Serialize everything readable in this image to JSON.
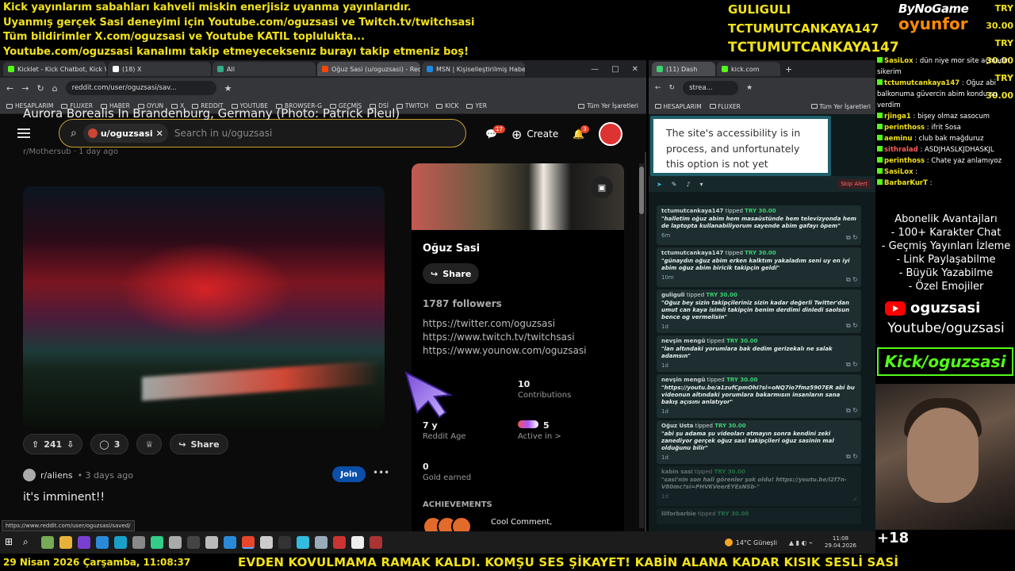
{
  "banner_lines": [
    "Kick yayınlarım sabahları kahveli miskin enerjisiz uyanma yayınlarıdır.",
    "Uyanmış gerçek Sasi deneyimi için Youtube.com/oguzsasi ve Twitch.tv/twitchsasi",
    "Tüm bildirimler X.com/oguzsasi ve Youtube KATIL toplulukta...",
    "Youtube.com/oguzsasi kanalımı takip etmeyeceksenız burayı takip etmeniz boş!"
  ],
  "top_tippers": [
    "GULIGULI",
    "TCTUMUTCANKAYA147",
    "TCTUMUTCANKAYA147"
  ],
  "brand": {
    "line1": "ByNoGame",
    "line2": "oyunfor"
  },
  "top_amounts": [
    "TRY 30.00",
    "TRY 30.00",
    "TRY 30.00"
  ],
  "left_browser": {
    "tabs": [
      "Kicklet - Kick Chatbot, Kick W...",
      "(18) X",
      "All",
      "Oğuz Sasi (u/oguzsasi) - Redd...",
      "MSN | Kişiselleştirilmiş Haber..."
    ],
    "url": "reddit.com/user/oguzsasi/sav...",
    "bookmarks": [
      "HESAPLARIM",
      "FLUXER",
      "HABER",
      "OYUN",
      "X",
      "REDDIT",
      "YOUTUBE",
      "BROWSER-G",
      "GEÇMİŞ",
      "DSİ",
      "TWITCH",
      "KICK",
      "YER",
      "Tüm Yer İşaretleri"
    ],
    "search_chip": "u/oguzsasi",
    "search_placeholder": "Search in u/oguzsasi",
    "chat_badge": "17",
    "notif_badge": "3",
    "create_label": "Create",
    "post_meta": "r/Mothersub · 1 day ago",
    "post_title": "Aurora Borealis In Brandenburg, Germany (Photo: Patrick Pleul)",
    "upvotes": "241",
    "comments": "3",
    "share": "Share",
    "post2_sub": "r/aliens",
    "post2_time": "• 3 days ago",
    "join": "Join",
    "post2_title": "it's imminent!!",
    "status_url": "https://www.reddit.com/user/oguzsasi/saved/"
  },
  "profile": {
    "name": "Oğuz Sasi",
    "share": "Share",
    "followers": "1787 followers",
    "links": [
      "https://twitter.com/oguzsasi",
      "https://www.twitch.tv/twitchsasi",
      "https://www.younow.com/oguzsasi"
    ],
    "contributions_value": "10",
    "contributions_label": "Contributions",
    "age_value": "7 y",
    "age_label": "Reddit Age",
    "active_value": "5",
    "active_label": "Active in >",
    "gold_value": "0",
    "gold_label": "Gold earned",
    "achievements": "ACHIEVEMENTS",
    "achievement_name": "Cool Comment,"
  },
  "right_browser": {
    "tabs": [
      "(11) Dash",
      "kick.com"
    ],
    "url": "strea...",
    "bookmarks": [
      "HESAPLARIM",
      "FLUXER",
      "Tüm Yer İşaretleri"
    ],
    "tooltip": "The site's accessibility is in process, and unfortunately this option is not yet available.",
    "skip_alert": "Skip Alert",
    "tips": [
      {
        "who": "tctumutcankaya147",
        "verb": "tipped",
        "amount": "TRY 30.00",
        "msg": "\"halletim oğuz abim hem masaüstünde hem televizyonda hem de laptopta kullanabiliyorum sayende abim gafayı öpem\"",
        "time": "6m"
      },
      {
        "who": "tctumutcankaya147",
        "verb": "tipped",
        "amount": "TRY 30.00",
        "msg": "\"günaydın oğuz abim erken kalktım yakaladım seni uy en iyi abim oğuz abim biricik takipçin geldi\"",
        "time": "10m"
      },
      {
        "who": "guliguli",
        "verb": "tipped",
        "amount": "TRY 30.00",
        "msg": "\"Oğuz bey sizin takipçileriniz sizin kadar değerli Twitter'dan umut can kaya isimli takipçin benim derdimi dinledi saolsun bence og vermelisin\"",
        "time": "1d"
      },
      {
        "who": "nevşin mengü",
        "verb": "tipped",
        "amount": "TRY 30.00",
        "msg": "\"lan altındaki yorumlara bak dedim gerizekalı ne salak adamsın\"",
        "time": "1d"
      },
      {
        "who": "nevşin mengü",
        "verb": "tipped",
        "amount": "TRY 30.00",
        "msg": "\"https://youtu.be/a1zufCpmOhI?si=oNQ7io7fmz5907ER abi bu videonun altındaki yorumlara bakarmısın insanların sana bakış açısını anlatıyor\"",
        "time": "1d"
      },
      {
        "who": "Oğuz Usta",
        "verb": "tipped",
        "amount": "TRY 30.00",
        "msg": "\"abi şu adama şu videoları atmayın sonra kendini zeki zanediyor gerçek oğuz sasi takipçileri oğuz sasinin mal olduğunu bilir\"",
        "time": "1d"
      },
      {
        "who": "kabin sasi",
        "verb": "tipped",
        "amount": "TRY 30.00",
        "msg": "\"sasi'nin son hali görenler şok oldu! https://youtu.be/l2f7n-V80mc?si=PHVKVeerEYEsNSb-\"",
        "time": "1d"
      },
      {
        "who": "lilforbarbie",
        "verb": "tipped",
        "amount": "TRY 30.00",
        "msg": "",
        "time": ""
      }
    ]
  },
  "chat": [
    {
      "user": "SasiLox",
      "text": ": dün niye mor site açmadın sikerim",
      "color": "n"
    },
    {
      "user": "tctumutcankaya147",
      "text": ": Oğuz abi balkonuma güvercin abim kondu su verdim",
      "color": "n"
    },
    {
      "user": "rjinga1",
      "text": ": bişey olmaz sasocum",
      "color": "n"
    },
    {
      "user": "perinthoss",
      "text": ": ifrit Sosa",
      "color": "n"
    },
    {
      "user": "aeminu",
      "text": ": club bak mağduruz",
      "color": "n"
    },
    {
      "user": "sithralad",
      "text": ": ASDJHASLKJDHASKJL",
      "color": "p"
    },
    {
      "user": "perinthoss",
      "text": ": Chate yaz anlamıyoz",
      "color": "n"
    },
    {
      "user": "SasiLox",
      "text": ":",
      "color": "n"
    },
    {
      "user": "BarbarKurT",
      "text": ":",
      "color": "n"
    }
  ],
  "benefits": [
    "Abonelik Avantajları",
    "- 100+ Karakter Chat",
    "- Geçmiş Yayınları İzleme",
    "- Link Paylaşabilme",
    "- Büyük Yazabilme",
    "- Özel Emojiler"
  ],
  "yt_name": "oguzsasi",
  "yt_line": "Youtube/oguzsasi",
  "kick_line": "Kick/oguzsasi",
  "plus": "+18",
  "taskbar": {
    "weather": "14°C  Güneşli",
    "time": "11:08",
    "date": "29.04.2026"
  },
  "ticker": {
    "date": "29 Nisan 2026 Çarşamba, 11:08:37",
    "text": "EVDEN KOVULMAMA RAMAK KALDI. KOMŞU SES ŞİKAYET! KABİN ALANA KADAR KISIK SESLİ SASİ"
  },
  "colors": {
    "banner_yellow": "#f2e21a",
    "kick_green": "#53fc18",
    "reddit_orange": "#e8452d",
    "tip_green": "#3bd16f"
  }
}
